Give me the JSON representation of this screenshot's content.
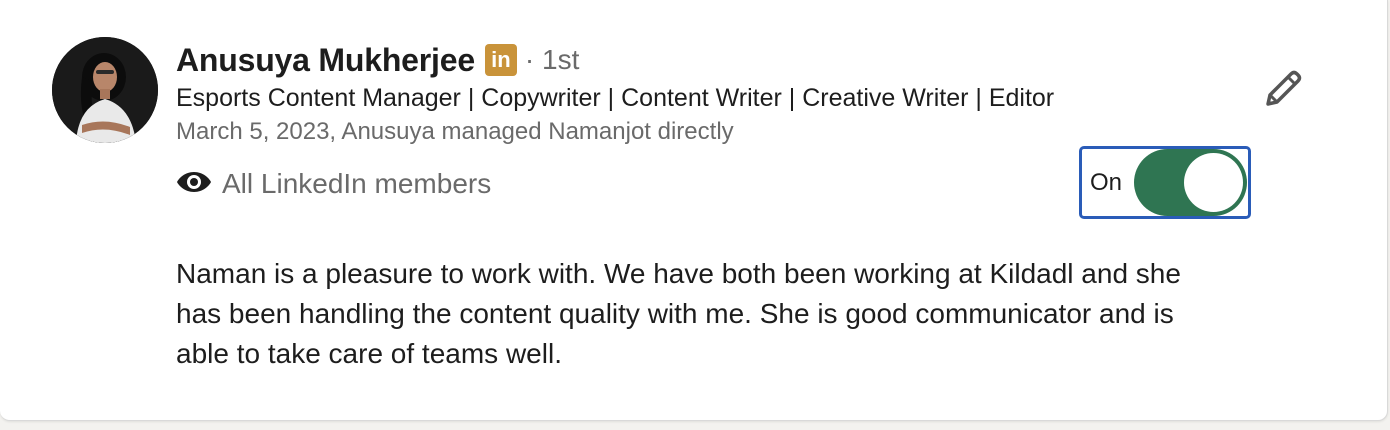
{
  "recommendation": {
    "author_name": "Anusuya Mukherjee",
    "badge_text": "in",
    "degree": "· 1st",
    "headline": "Esports Content Manager | Copywriter | Content Writer | Creative Writer | Editor",
    "meta": "March 5, 2023, Anusuya managed Namanjot directly",
    "visibility_label": "All LinkedIn members",
    "toggle_label": "On",
    "toggle_state": true,
    "text": "Naman is a pleasure to work with. We have both been working at Kildadl and she has been handling the content quality with me. She is good communicator and is able to take care of teams well."
  },
  "icons": {
    "visibility": "eye-icon",
    "edit": "pencil-icon",
    "badge": "linkedin-icon"
  },
  "colors": {
    "toggle_on": "#2f7552",
    "focus_ring": "#2a5cb8",
    "badge": "#c9933a",
    "secondary_text": "#6a6a6a",
    "primary_text": "#1d1d1d"
  }
}
